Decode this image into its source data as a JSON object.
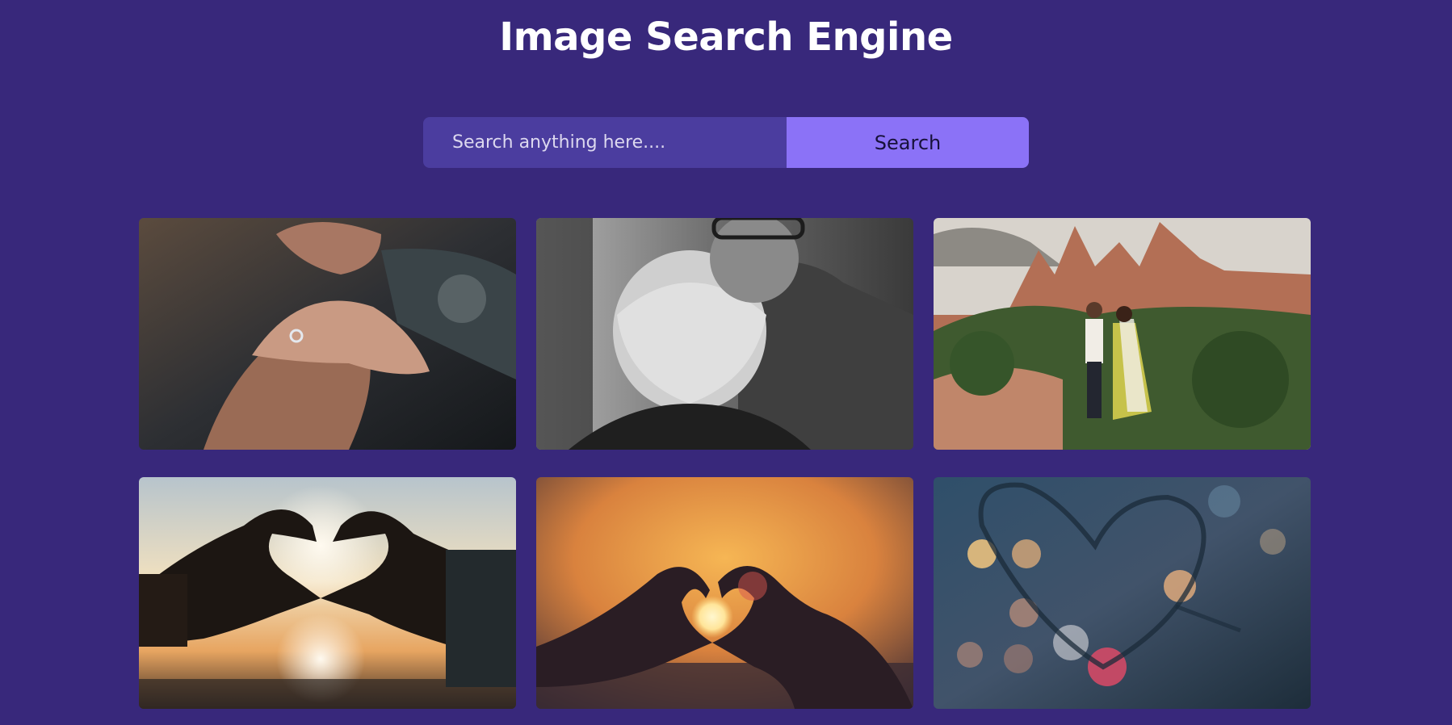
{
  "header": {
    "title": "Image Search Engine"
  },
  "search": {
    "placeholder": "Search anything here....",
    "value": "",
    "button_label": "Search"
  },
  "results": [
    {
      "name": "result-image-hands-with-ring"
    },
    {
      "name": "result-image-elderly-couple-bw"
    },
    {
      "name": "result-image-couple-in-mountains"
    },
    {
      "name": "result-image-heart-hands-sunset"
    },
    {
      "name": "result-image-heart-hands-sun"
    },
    {
      "name": "result-image-heart-bokeh-window"
    }
  ],
  "colors": {
    "background": "#38287b",
    "input_background": "#4b3d9f",
    "button_background": "#8b72f7"
  }
}
